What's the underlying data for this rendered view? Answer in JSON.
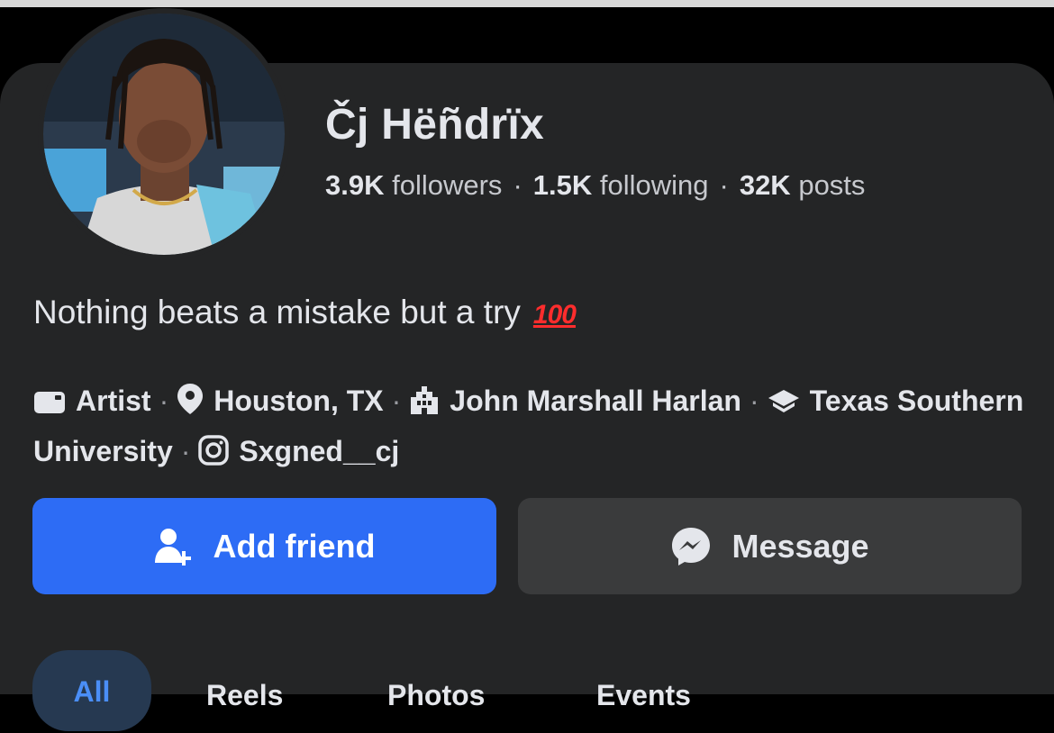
{
  "profile": {
    "name": "Čj Hëñdrïx",
    "stats": {
      "followers_value": "3.9K",
      "followers_label": "followers",
      "following_value": "1.5K",
      "following_label": "following",
      "posts_value": "32K",
      "posts_label": "posts",
      "separator": "·"
    },
    "bio": "Nothing beats a mistake but a try",
    "bio_emoji": "100",
    "details": [
      {
        "icon": "briefcase-icon",
        "text": "Artist"
      },
      {
        "icon": "location-pin-icon",
        "text": "Houston, TX"
      },
      {
        "icon": "building-icon",
        "text": "John Marshall Harlan"
      },
      {
        "icon": "graduation-cap-icon",
        "text": "Texas Southern University"
      },
      {
        "icon": "instagram-icon",
        "text": "Sxgned__cj"
      }
    ],
    "detail_separator": "·"
  },
  "actions": {
    "add_friend_label": "Add friend",
    "message_label": "Message"
  },
  "tabs": [
    {
      "label": "All",
      "active": true
    },
    {
      "label": "Reels",
      "active": false
    },
    {
      "label": "Photos",
      "active": false
    },
    {
      "label": "Events",
      "active": false
    }
  ],
  "colors": {
    "background": "#000000",
    "card": "#242526",
    "primary_button": "#2d6cf5",
    "secondary_button": "#3a3b3c",
    "active_tab_bg": "#263951",
    "active_tab_text": "#4a8ef7"
  }
}
